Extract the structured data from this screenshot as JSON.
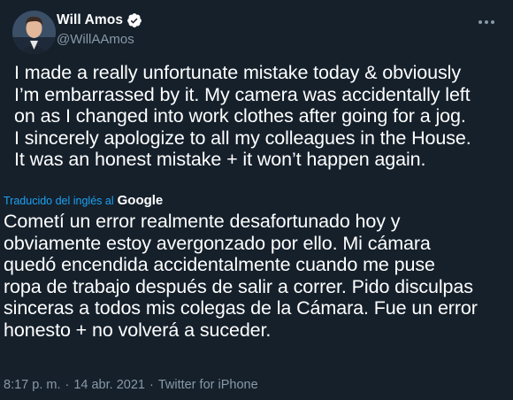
{
  "author": {
    "display_name": "Will Amos",
    "handle": "@WillAAmos",
    "verified": true
  },
  "icons": {
    "more": "more-options-icon",
    "verified": "verified-badge-icon",
    "avatar": "avatar"
  },
  "tweet": {
    "text": "I made a really unfortunate mistake today & obviously\nI’m embarrassed by it. My camera was accidentally left\non as I changed into work clothes after going for a jog.\nI sincerely apologize to all my colleagues in the House.\nIt was an honest mistake + it won’t happen again.",
    "translated_by": "Traducido del inglés al",
    "translator_brand": "Google",
    "translation": "Cometí un error realmente desafortunado hoy y\nobviamente estoy avergonzado por ello. Mi cámara\nquedó encendida accidentalmente cuando me puse\nropa de trabajo después de salir a correr. Pido disculpas\nsinceras a todos mis colegas de la Cámara. Fue un error\nhonesto + no volverá a suceder.",
    "time": "8:17 p. m.",
    "date": "14 abr. 2021",
    "source": "Twitter for iPhone"
  },
  "colors": {
    "background": "#15202b",
    "text": "#ffffff",
    "secondary": "#8899a6",
    "link": "#1da1f2"
  }
}
